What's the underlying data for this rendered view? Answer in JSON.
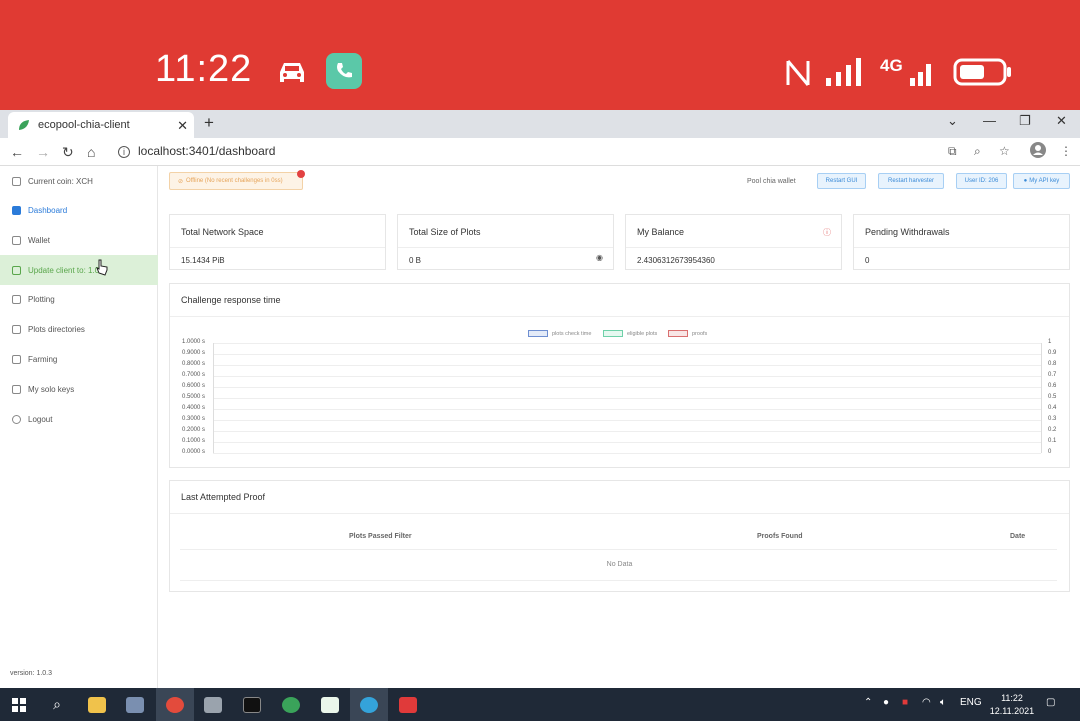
{
  "phone": {
    "time": "11:22",
    "network": "4G"
  },
  "browser": {
    "tab_title": "ecopool-chia-client",
    "url": "localhost:3401/dashboard"
  },
  "sidebar": {
    "items": [
      {
        "label": "Current coin: XCH"
      },
      {
        "label": "Dashboard"
      },
      {
        "label": "Wallet"
      },
      {
        "label": "Update client to: 1.0"
      },
      {
        "label": "Plotting"
      },
      {
        "label": "Plots directories"
      },
      {
        "label": "Farming"
      },
      {
        "label": "My solo keys"
      },
      {
        "label": "Logout"
      }
    ],
    "version": "version: 1.0.3"
  },
  "header": {
    "alert": "Offline (No recent challenges in 0ss)",
    "pool_wallet": "Pool chia wallet",
    "restart_gui": "Restart GUI",
    "restart_harvester": "Restart harvester",
    "user_id": "User ID: 206",
    "api_key": "My API key"
  },
  "cards": [
    {
      "title": "Total Network Space",
      "value": "15.1434 PiB"
    },
    {
      "title": "Total Size of Plots",
      "value": "0 B"
    },
    {
      "title": "My Balance",
      "value": "2.4306312673954360"
    },
    {
      "title": "Pending Withdrawals",
      "value": "0"
    }
  ],
  "chart": {
    "title": "Challenge response time",
    "legend": [
      "plots check time",
      "eligible plots",
      "proofs"
    ],
    "y_left": [
      "1.0000 s",
      "0.9000 s",
      "0.8000 s",
      "0.7000 s",
      "0.6000 s",
      "0.5000 s",
      "0.4000 s",
      "0.3000 s",
      "0.2000 s",
      "0.1000 s",
      "0.0000 s"
    ],
    "y_right": [
      "1",
      "0.9",
      "0.8",
      "0.7",
      "0.6",
      "0.5",
      "0.4",
      "0.3",
      "0.2",
      "0.1",
      "0"
    ]
  },
  "chart_data": {
    "type": "line",
    "title": "Challenge response time",
    "series": [
      {
        "name": "plots check time",
        "values": [],
        "color": "#6f8fd1"
      },
      {
        "name": "eligible plots",
        "values": [],
        "color": "#6fd1a9"
      },
      {
        "name": "proofs",
        "values": [],
        "color": "#d97070"
      }
    ],
    "ylim": [
      0,
      1
    ],
    "y2lim": [
      0,
      1
    ],
    "legend": "top-center",
    "grid": true
  },
  "proof_table": {
    "title": "Last Attempted Proof",
    "columns": [
      "Plots Passed Filter",
      "Proofs Found",
      "Date"
    ],
    "empty": "No Data"
  },
  "taskbar": {
    "lang": "ENG",
    "time": "11:22",
    "date": "12.11.2021"
  }
}
